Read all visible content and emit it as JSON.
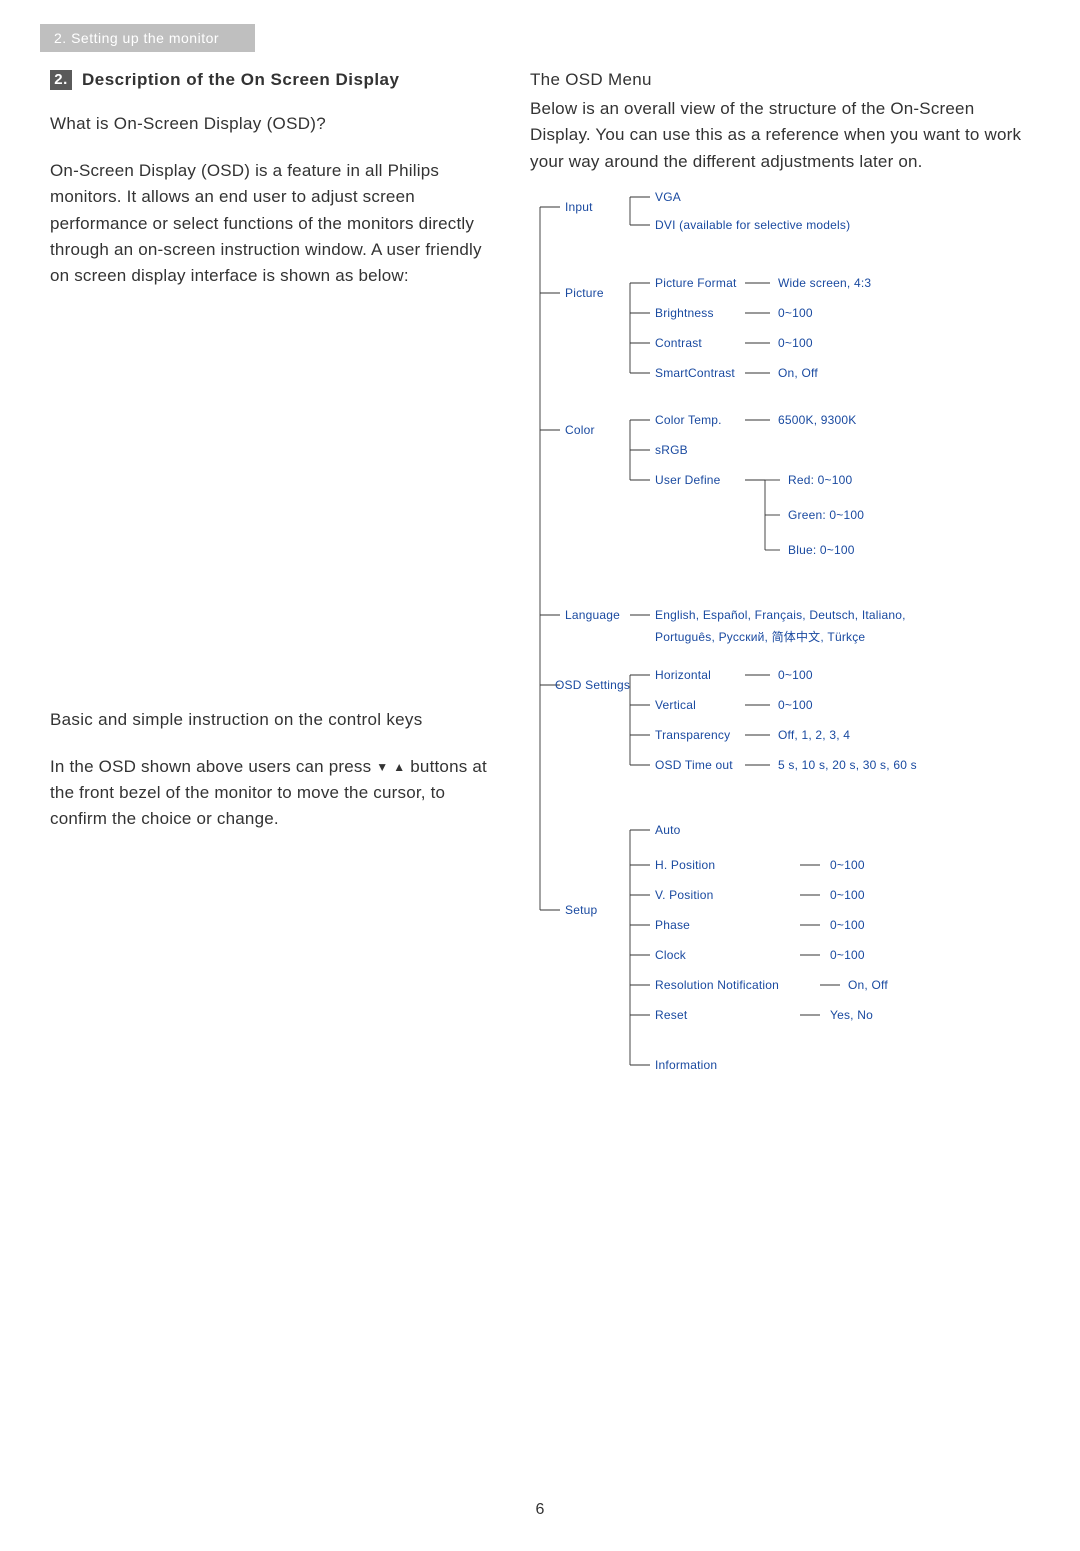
{
  "breadcrumb": "2. Setting up the monitor",
  "section_num": "2.",
  "section_title": "Description of the On Screen Display",
  "q1": "What is On-Screen Display (OSD)?",
  "p1": "On-Screen Display (OSD) is a feature in all Philips monitors. It allows an end user to adjust screen performance or select functions of the monitors directly through an on-screen instruction window. A user friendly on screen display interface is shown as below:",
  "keys_heading": "Basic and simple instruction on the control keys",
  "p2a": "In the OSD shown above users can press ",
  "p2b": " buttons at the front bezel of the monitor to move the cursor,  to confirm the choice or change.",
  "menu_heading": "The OSD Menu",
  "menu_intro": "Below is an overall view of the structure of the On-Screen Display. You can use this as a reference when you want to work your way around the different adjustments later on.",
  "page_number": "6",
  "tree": {
    "input": {
      "label": "Input",
      "vga": "VGA",
      "dvi": "DVI (available for selective models)"
    },
    "picture": {
      "label": "Picture",
      "format": "Picture Format",
      "format_v": "Wide screen, 4:3",
      "bright": "Brightness",
      "bright_v": "0~100",
      "contrast": "Contrast",
      "contrast_v": "0~100",
      "smart": "SmartContrast",
      "smart_v": "On, Off"
    },
    "color": {
      "label": "Color",
      "temp": "Color Temp.",
      "temp_v": "6500K, 9300K",
      "srgb": "sRGB",
      "user": "User Define",
      "red": "Red: 0~100",
      "green": "Green: 0~100",
      "blue": "Blue: 0~100"
    },
    "language": {
      "label": "Language",
      "line1": "English, Español, Français, Deutsch, Italiano,",
      "line2": "Português,   Русский,   简体中文,   Türkçe"
    },
    "osd": {
      "label": "OSD Settings",
      "horiz": "Horizontal",
      "horiz_v": "0~100",
      "vert": "Vertical",
      "vert_v": "0~100",
      "transp": "Transparency",
      "transp_v": "Off, 1, 2, 3, 4",
      "timeout": "OSD Time out",
      "timeout_v": "5 s, 10 s, 20 s, 30 s, 60 s"
    },
    "setup": {
      "label": "Setup",
      "auto": "Auto",
      "hpos": "H. Position",
      "hpos_v": "0~100",
      "vpos": "V. Position",
      "vpos_v": "0~100",
      "phase": "Phase",
      "phase_v": "0~100",
      "clock": "Clock",
      "clock_v": "0~100",
      "resnot": "Resolution Notification",
      "resnot_v": "On, Off",
      "reset": "Reset",
      "reset_v": "Yes, No",
      "info": "Information"
    }
  }
}
